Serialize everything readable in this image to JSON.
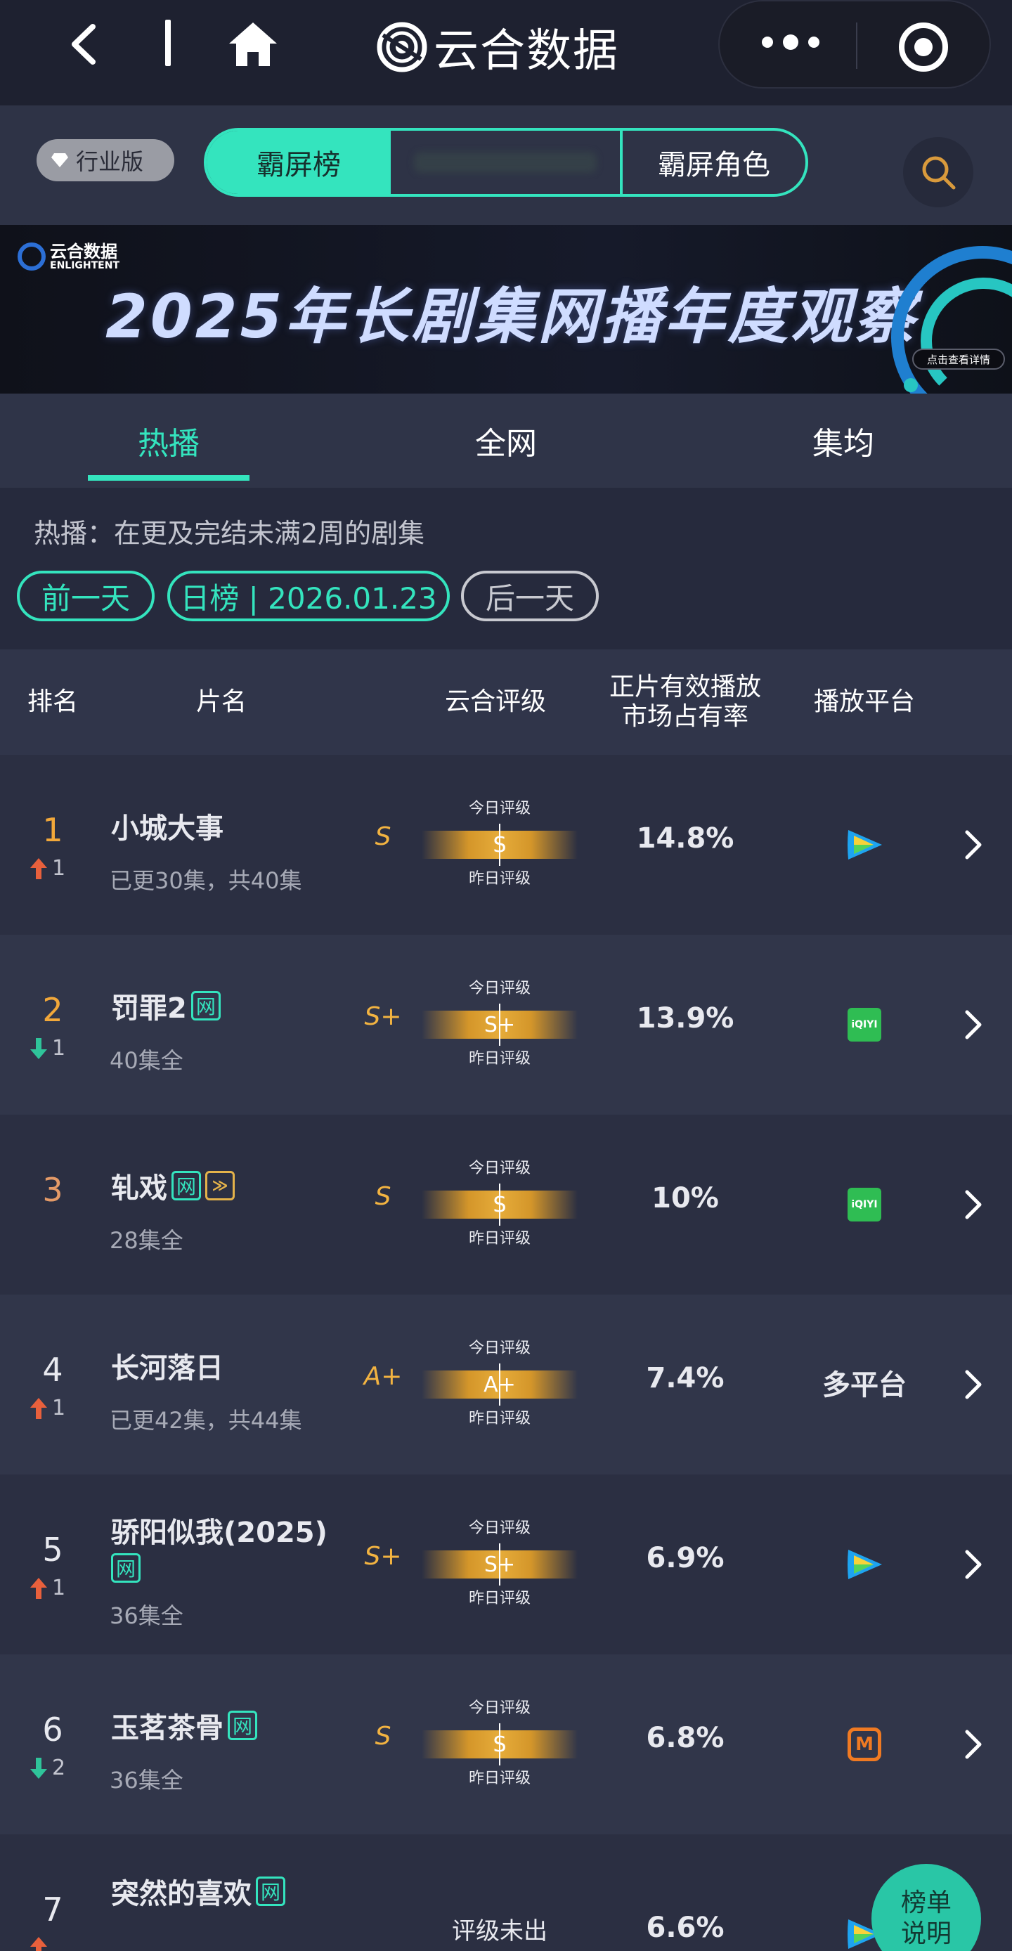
{
  "nav": {
    "brand": "云合数据",
    "back_icon": "chevron-left-icon",
    "home_icon": "home-icon",
    "more_icon": "more-dots-icon",
    "target_icon": "target-icon"
  },
  "toolbar": {
    "industry_badge": "行业版",
    "segments": [
      "霸屏榜",
      "霸屏角色"
    ],
    "search_icon": "search-icon"
  },
  "banner": {
    "logo_cn": "云合数据",
    "logo_en": "ENLIGHTENT",
    "headline": "2025年长剧集网播年度观察",
    "detail_label": "点击查看详情"
  },
  "tabs": [
    "热播",
    "全网",
    "集均"
  ],
  "info": {
    "description": "热播：在更及完结未满2周的剧集",
    "prev_day": "前一天",
    "date_label": "日榜 | 2026.01.23",
    "next_day": "后一天"
  },
  "table_header": {
    "rank": "排名",
    "title": "片名",
    "rating": "云合评级",
    "share": "正片有效播放市场占有率",
    "platform": "播放平台"
  },
  "rating_labels": {
    "today": "今日评级",
    "yesterday": "昨日评级"
  },
  "rows": [
    {
      "rank": "1",
      "trend": "up",
      "trend_value": "1",
      "title": "小城大事",
      "tags": [],
      "subtitle": "已更30集，共40集",
      "rating": "S",
      "rating_bar": "S",
      "share": "14.8%",
      "platform": "tencent-video"
    },
    {
      "rank": "2",
      "trend": "down",
      "trend_value": "1",
      "title": "罚罪2",
      "tags": [
        "网"
      ],
      "subtitle": "40集全",
      "rating": "S+",
      "rating_bar": "S+",
      "share": "13.9%",
      "platform": "iqiyi"
    },
    {
      "rank": "3",
      "trend": "none",
      "trend_value": "",
      "title": "轧戏",
      "tags": [
        "网",
        "≫"
      ],
      "subtitle": "28集全",
      "rating": "S",
      "rating_bar": "S",
      "share": "10%",
      "platform": "iqiyi"
    },
    {
      "rank": "4",
      "trend": "up",
      "trend_value": "1",
      "title": "长河落日",
      "tags": [],
      "subtitle": "已更42集，共44集",
      "rating": "A+",
      "rating_bar": "A+",
      "share": "7.4%",
      "platform_text": "多平台"
    },
    {
      "rank": "5",
      "trend": "up",
      "trend_value": "1",
      "title": "骄阳似我(2025)",
      "tags": [
        "网"
      ],
      "subtitle": "36集全",
      "rating": "S+",
      "rating_bar": "S+",
      "share": "6.9%",
      "platform": "tencent-video"
    },
    {
      "rank": "6",
      "trend": "down",
      "trend_value": "2",
      "title": "玉茗茶骨",
      "tags": [
        "网"
      ],
      "subtitle": "36集全",
      "rating": "S",
      "rating_bar": "S",
      "share": "6.8%",
      "platform": "mango-tv"
    },
    {
      "rank": "7",
      "trend": "up",
      "trend_value": "",
      "title": "突然的喜欢",
      "tags": [
        "网"
      ],
      "subtitle": "",
      "rating_pending": "评级未出",
      "share": "6.6%",
      "platform": "tencent-video"
    }
  ],
  "platform_labels": {
    "iqiyi": "iQIYI",
    "mango": "M"
  },
  "fab": {
    "line1": "榜单",
    "line2": "说明"
  },
  "colors": {
    "accent": "#34e4be",
    "gold": "#f2b341",
    "up": "#e8603c",
    "down": "#2fc49a"
  }
}
